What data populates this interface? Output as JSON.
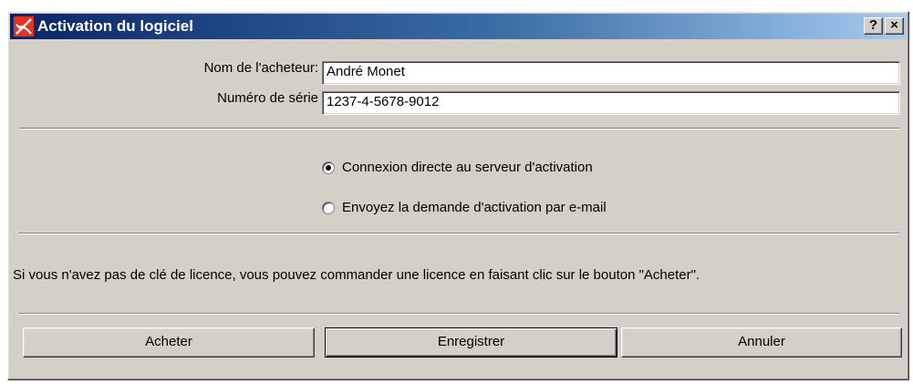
{
  "window": {
    "title": "Activation du logiciel",
    "help_button": "?",
    "close_button": "×"
  },
  "form": {
    "buyer_label": "Nom de l'acheteur:",
    "buyer_value": "André Monet",
    "serial_label": "Numéro de série",
    "serial_value": "1237-4-5678-9012"
  },
  "options": {
    "direct": "Connexion directe au serveur d'activation",
    "email": "Envoyez la demande d'activation par e-mail",
    "selected": "direct"
  },
  "info_text": "Si vous n'avez pas de clé de licence, vous pouvez commander une licence en faisant clic sur le bouton \"Acheter\".",
  "buttons": {
    "buy": "Acheter",
    "register": "Enregistrer",
    "cancel": "Annuler"
  },
  "colors": {
    "titlebar_start": "#0a246a",
    "titlebar_end": "#a6caf0",
    "dialog_bg": "#d4d0c8",
    "logo": "#e8321e"
  },
  "icons": {
    "title": "app-logo-icon"
  }
}
